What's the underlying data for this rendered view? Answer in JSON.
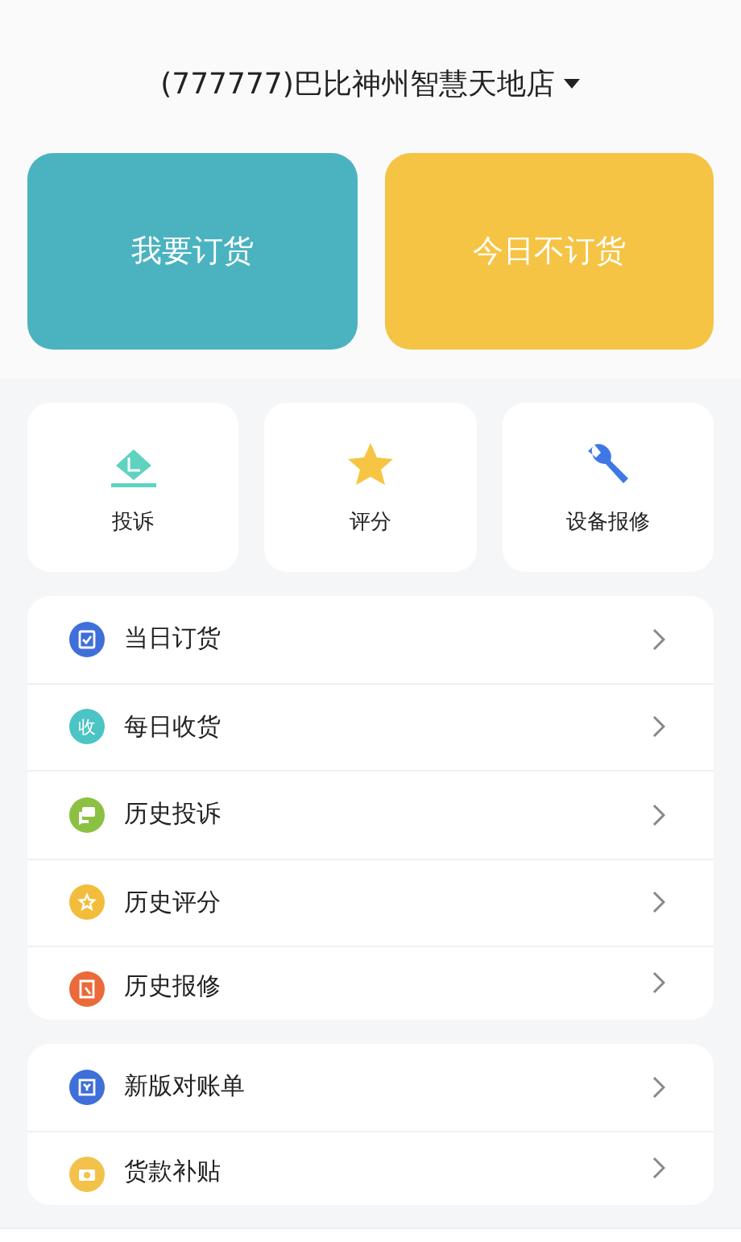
{
  "store_selector": {
    "label": "(777777)巴比神州智慧天地店"
  },
  "actions": [
    {
      "label": "我要订货",
      "color": "#4bb3c0"
    },
    {
      "label": "今日不订货",
      "color": "#f5c445"
    }
  ],
  "tiles": [
    {
      "label": "投诉",
      "kind": "envelope"
    },
    {
      "label": "评分",
      "kind": "star"
    },
    {
      "label": "设备报修",
      "kind": "wrench"
    }
  ],
  "menu_groups": [
    [
      {
        "label": "当日订货",
        "kind": "clipboard",
        "color": "#3f6fd8"
      },
      {
        "label": "每日收货",
        "kind": "text",
        "badge": "收",
        "color": "#4cc4c4"
      },
      {
        "label": "历史投诉",
        "kind": "chat",
        "color": "#8cc043"
      },
      {
        "label": "历史评分",
        "kind": "star",
        "color": "#f2bd3c"
      },
      {
        "label": "历史报修",
        "kind": "receipt",
        "color": "#ea6a3a"
      }
    ],
    [
      {
        "label": "新版对账单",
        "kind": "document",
        "color": "#3f6fd8"
      },
      {
        "label": "货款补贴",
        "kind": "camera",
        "color": "#f2c24a"
      }
    ]
  ]
}
